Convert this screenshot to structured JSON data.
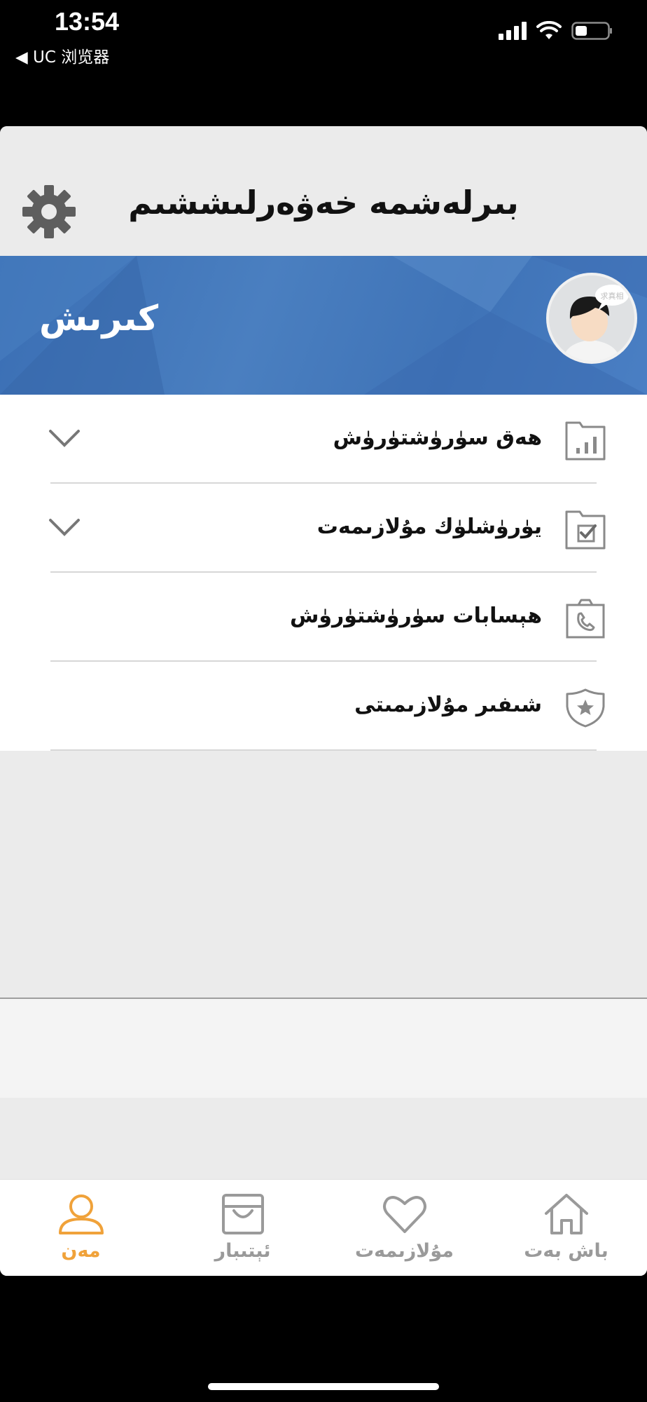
{
  "status_bar": {
    "time": "13:54",
    "back_app": "◀ UC 浏览器",
    "icons": [
      "signal-icon",
      "wifi-icon",
      "battery-icon"
    ]
  },
  "header": {
    "title": "بىرلەشمە خەۋەرلىششىم",
    "settings_icon": "gear-icon"
  },
  "banner": {
    "login_label": "كىرىش",
    "avatar_caption": "求真相",
    "colors": {
      "banner": "#4676b9"
    }
  },
  "menu": {
    "items": [
      {
        "label": "ھەق سۈرۈشتۈرۈش",
        "icon": "bar-chart-icon",
        "has_chevron": true
      },
      {
        "label": "يۈرۈشلۈك مۇلازىمەت",
        "icon": "folder-check-icon",
        "has_chevron": true
      },
      {
        "label": "ھېسابات سۈرۈشتۈرۈش",
        "icon": "clipboard-phone-icon",
        "has_chevron": false
      },
      {
        "label": "شىفىر مۇلازىمىتى",
        "icon": "shield-star-icon",
        "has_chevron": false
      }
    ]
  },
  "tabbar": {
    "tabs": [
      {
        "label": "مەن",
        "icon": "person-icon",
        "active": true
      },
      {
        "label": "ئېتىبار",
        "icon": "bag-icon",
        "active": false
      },
      {
        "label": "مۇلازىمەت",
        "icon": "heart-icon",
        "active": false
      },
      {
        "label": "باش بەت",
        "icon": "home-icon",
        "active": false
      }
    ],
    "colors": {
      "active": "#f0a23a",
      "inactive": "#9a9a9a"
    }
  }
}
